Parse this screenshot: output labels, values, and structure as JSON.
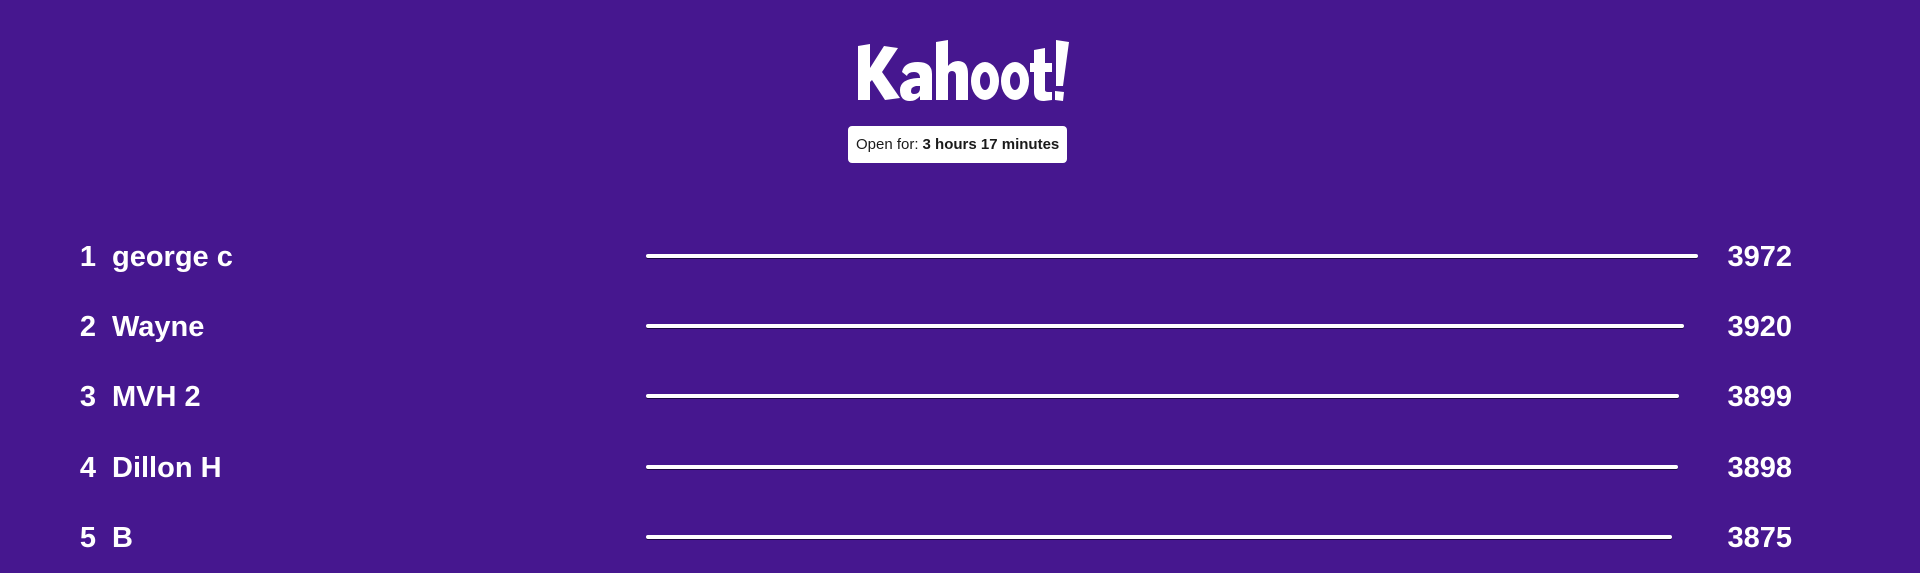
{
  "header": {
    "logo_text": "Kahoot!",
    "timer_label": "Open for:",
    "timer_value": "3 hours 17 minutes"
  },
  "leaderboard": {
    "max_score": 3972,
    "entries": [
      {
        "rank": "1",
        "name": "george c",
        "score": "3972",
        "score_value": 3972
      },
      {
        "rank": "2",
        "name": "Wayne",
        "score": "3920",
        "score_value": 3920
      },
      {
        "rank": "3",
        "name": "MVH 2",
        "score": "3899",
        "score_value": 3899
      },
      {
        "rank": "4",
        "name": "Dillon H",
        "score": "3898",
        "score_value": 3898
      },
      {
        "rank": "5",
        "name": "B",
        "score": "3875",
        "score_value": 3875
      }
    ]
  },
  "colors": {
    "background": "#46178F",
    "text": "#FFFFFF",
    "badge_background": "#FFFFFF",
    "badge_text": "#1B1B1B",
    "bar": "#FFFFFF"
  }
}
